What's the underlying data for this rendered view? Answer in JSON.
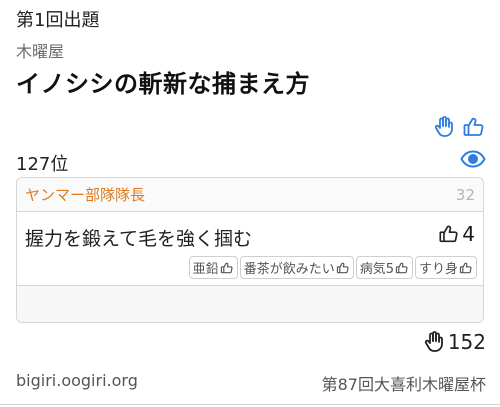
{
  "header": {
    "round": "第1回出題",
    "author": "木曜屋",
    "title": "イノシシの斬新な捕まえ方"
  },
  "rank": "127位",
  "entry": {
    "user": "ヤンマー部隊隊長",
    "number": "32",
    "answer": "握力を鍛えて毛を強く掴む",
    "likes": "4",
    "comments": [
      {
        "text": "亜鉛"
      },
      {
        "text": "番茶が飲みたい"
      },
      {
        "text": "病気5"
      },
      {
        "text": "すり身"
      }
    ]
  },
  "votes": "152",
  "footer": {
    "site": "bigiri.oogiri.org",
    "event": "第87回大喜利木曜屋杯"
  },
  "colors": {
    "accent": "#2f7de1",
    "user": "#e07a1f"
  },
  "icons": [
    "hand-icon",
    "thumbs-up-icon",
    "eye-icon",
    "hand-vote-icon"
  ]
}
